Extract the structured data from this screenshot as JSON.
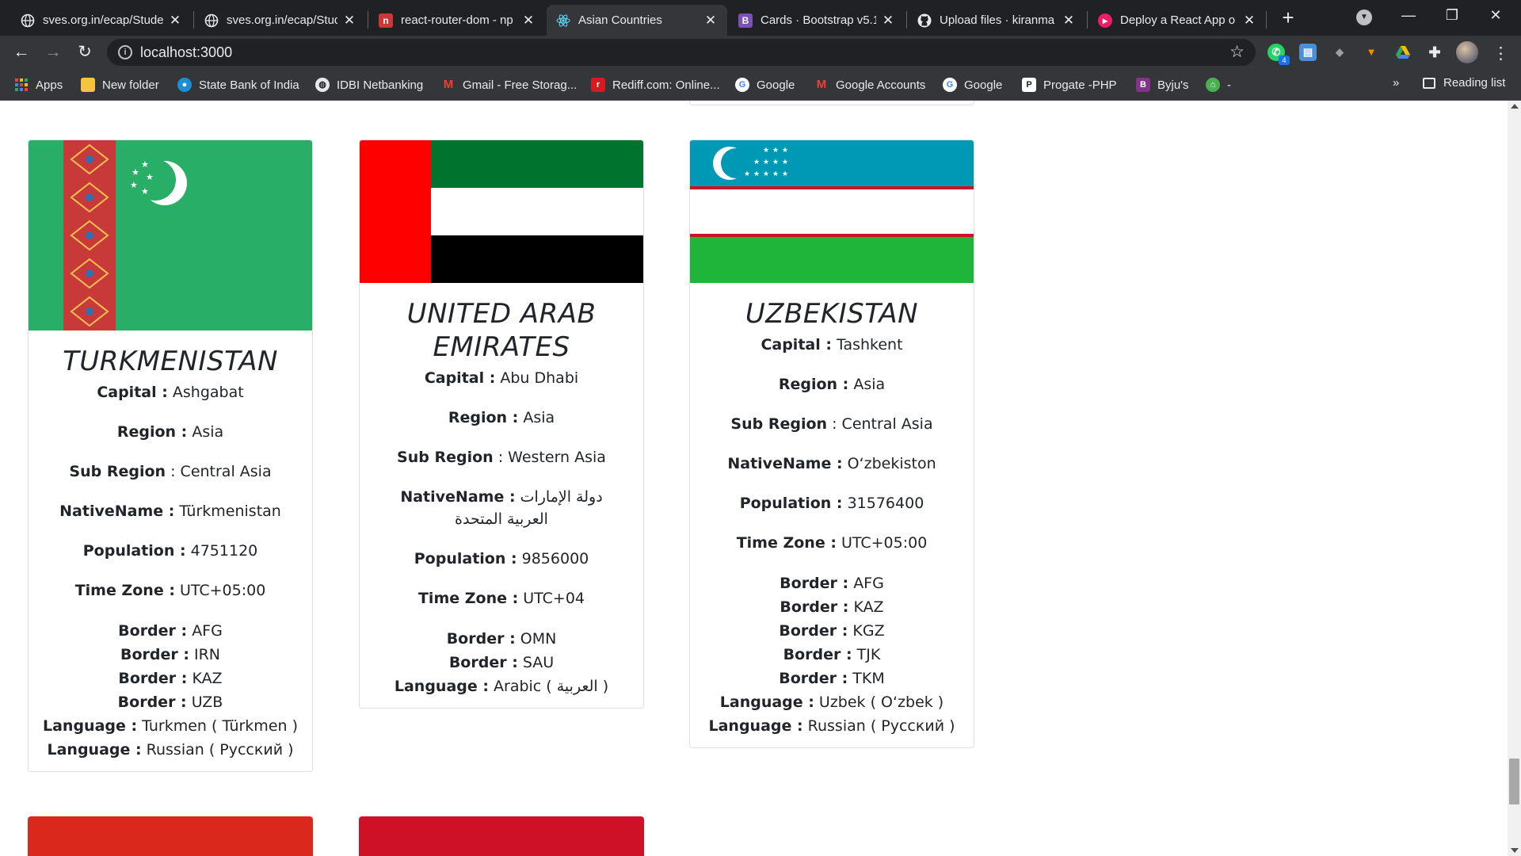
{
  "browser": {
    "tabs": [
      {
        "title": "sves.org.in/ecap/Stude",
        "favicon": "globe-icon"
      },
      {
        "title": "sves.org.in/ecap/Stude",
        "favicon": "globe-icon"
      },
      {
        "title": "react-router-dom - np",
        "favicon": "npm-icon"
      },
      {
        "title": "Asian Countries",
        "favicon": "react-icon"
      },
      {
        "title": "Cards · Bootstrap v5.1",
        "favicon": "bootstrap-icon"
      },
      {
        "title": "Upload files · kiranma",
        "favicon": "github-icon"
      },
      {
        "title": "Deploy a React App o",
        "favicon": "app-icon"
      }
    ],
    "active_tab": "Asian Countries",
    "url": "localhost:3000",
    "extension_badge": "4",
    "bookmarks": [
      {
        "label": "Apps",
        "icon": "apps-grid-icon"
      },
      {
        "label": "New folder",
        "icon": "folder-icon"
      },
      {
        "label": "State Bank of India",
        "icon": "sbi-icon"
      },
      {
        "label": "IDBI Netbanking",
        "icon": "idbi-icon"
      },
      {
        "label": "Gmail - Free Storag...",
        "icon": "gmail-icon"
      },
      {
        "label": "Rediff.com: Online...",
        "icon": "rediff-icon"
      },
      {
        "label": "Google",
        "icon": "google-icon"
      },
      {
        "label": "Google Accounts",
        "icon": "gmail-icon"
      },
      {
        "label": "Google",
        "icon": "google-icon"
      },
      {
        "label": "Progate -PHP",
        "icon": "progate-icon"
      },
      {
        "label": "Byju's",
        "icon": "byjus-icon"
      },
      {
        "label": "-",
        "icon": "green-icon"
      }
    ],
    "bookmarks_overflow": "»",
    "reading_list": "Reading list"
  },
  "labels": {
    "capital": "Capital :",
    "region": "Region :",
    "subregion": "Sub Region",
    "subregion_sep": " :",
    "nativename": "NativeName :",
    "population": "Population :",
    "timezone": "Time Zone :",
    "border": "Border :",
    "language": "Language :"
  },
  "countries": [
    {
      "name": "TURKMENISTAN",
      "flag": "turkmenistan-flag",
      "capital": "Ashgabat",
      "region": "Asia",
      "subregion": "Central Asia",
      "nativename": "Türkmenistan",
      "population": "4751120",
      "timezone": "UTC+05:00",
      "borders": [
        "AFG",
        "IRN",
        "KAZ",
        "UZB"
      ],
      "languages": [
        "Turkmen ( Türkmen )",
        "Russian ( Русский )"
      ]
    },
    {
      "name": "UNITED ARAB EMIRATES",
      "flag": "uae-flag",
      "capital": "Abu Dhabi",
      "region": "Asia",
      "subregion": "Western Asia",
      "nativename": "دولة الإمارات العربية المتحدة",
      "population": "9856000",
      "timezone": "UTC+04",
      "borders": [
        "OMN",
        "SAU"
      ],
      "languages": [
        "Arabic ( العربية )"
      ]
    },
    {
      "name": "UZBEKISTAN",
      "flag": "uzbekistan-flag",
      "capital": "Tashkent",
      "region": "Asia",
      "subregion": "Central Asia",
      "nativename": "Oʻzbekiston",
      "population": "31576400",
      "timezone": "UTC+05:00",
      "borders": [
        "AFG",
        "KAZ",
        "KGZ",
        "TJK",
        "TKM"
      ],
      "languages": [
        "Uzbek ( Oʻzbek )",
        "Russian ( Русский )"
      ]
    }
  ],
  "colors": {
    "chrome_dark": "#202124",
    "chrome_toolbar": "#35363a",
    "turkmen_green": "#28ae66",
    "turkmen_carpet": "#c83a3a",
    "uae_red": "#ff0000",
    "uae_green": "#00732f",
    "uz_blue": "#0099b5",
    "uz_green": "#1eb53a",
    "uz_red": "#ce1126",
    "next_row_flag_1": "#da291c",
    "next_row_flag_2": "#ce1126"
  }
}
